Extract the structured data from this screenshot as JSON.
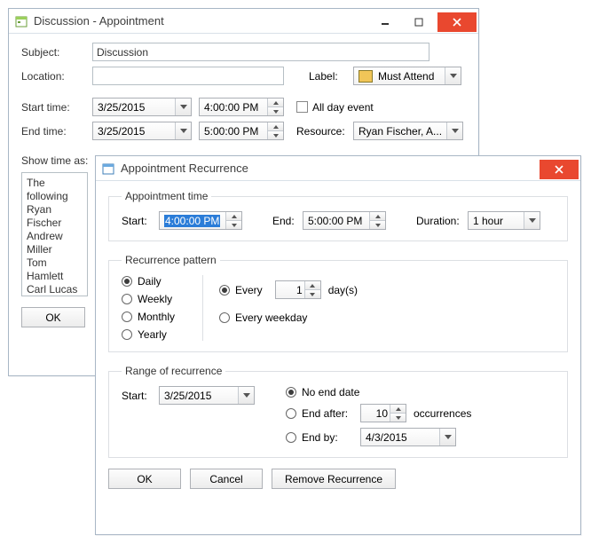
{
  "appt": {
    "title": "Discussion - Appointment",
    "labels": {
      "subject": "Subject:",
      "location": "Location:",
      "label": "Label:",
      "start_time": "Start time:",
      "end_time": "End time:",
      "all_day": "All day event",
      "resource": "Resource:",
      "show_as": "Show time as:"
    },
    "subject_value": "Discussion",
    "location_value": "",
    "label_value": "Must Attend",
    "start_date": "3/25/2015",
    "start_time": "4:00:00 PM",
    "end_date": "3/25/2015",
    "end_time": "5:00:00 PM",
    "resource_value": "Ryan Fischer, A...",
    "memo": {
      "l1": "The following",
      "l2": "Ryan Fischer",
      "l3": "Andrew Miller",
      "l4": "Tom Hamlett",
      "l5": "Carl Lucas"
    },
    "ok": "OK"
  },
  "recur": {
    "title": "Appointment Recurrence",
    "groups": {
      "time": "Appointment time",
      "pattern": "Recurrence pattern",
      "range": "Range of recurrence"
    },
    "labels": {
      "start": "Start:",
      "end": "End:",
      "duration": "Duration:",
      "daily": "Daily",
      "weekly": "Weekly",
      "monthly": "Monthly",
      "yearly": "Yearly",
      "every": "Every",
      "days_suffix": "day(s)",
      "every_weekday": "Every weekday",
      "range_start": "Start:",
      "no_end": "No end date",
      "end_after": "End after:",
      "occurrences": "occurrences",
      "end_by": "End by:"
    },
    "start_time": "4:00:00 PM",
    "end_time": "5:00:00 PM",
    "duration": "1 hour",
    "every_n": "1",
    "range_start_date": "3/25/2015",
    "end_after_n": "10",
    "end_by_date": "4/3/2015",
    "buttons": {
      "ok": "OK",
      "cancel": "Cancel",
      "remove": "Remove Recurrence"
    }
  }
}
